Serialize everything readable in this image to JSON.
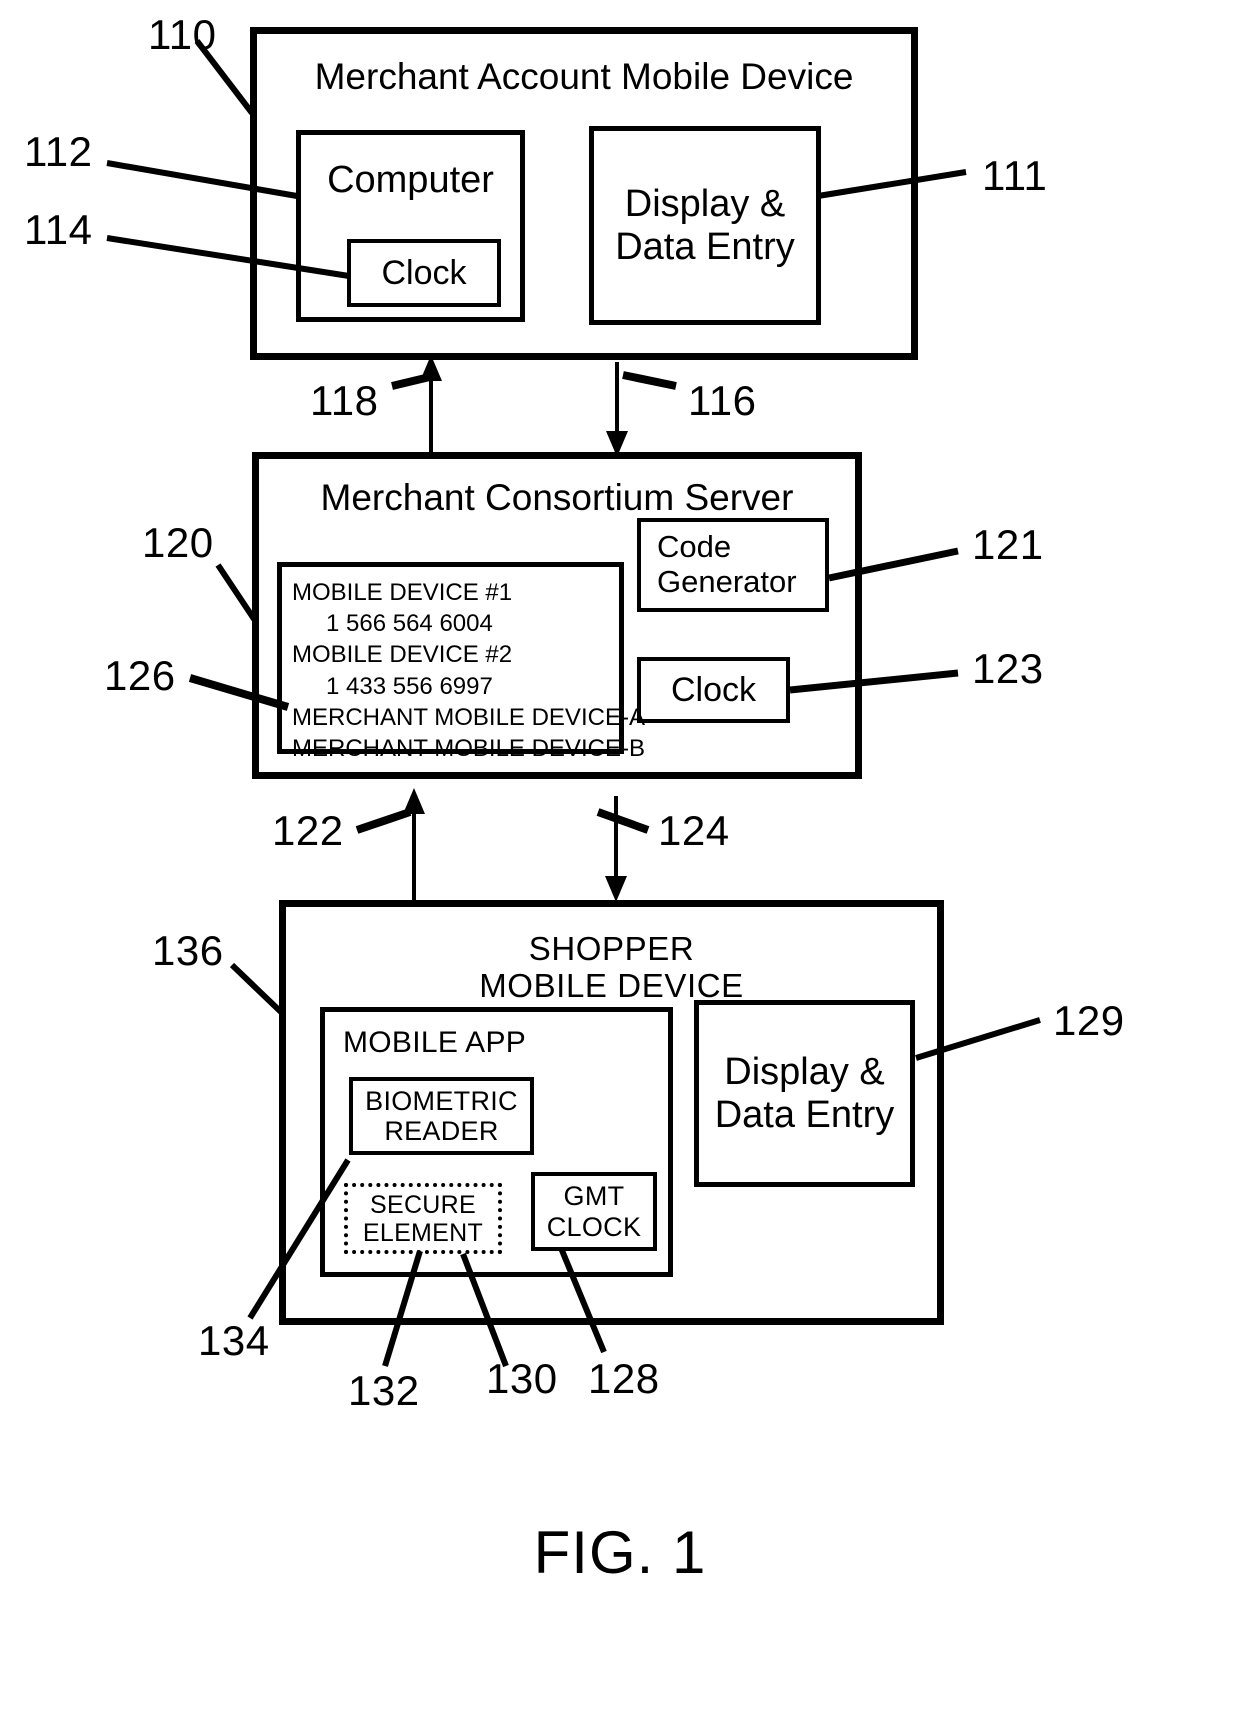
{
  "figure": {
    "caption": "FIG. 1"
  },
  "blocks": {
    "merchant_account_mobile_device": {
      "title": "Merchant Account Mobile Device",
      "ref": "110",
      "computer": {
        "label": "Computer",
        "ref": "112",
        "clock": {
          "label": "Clock",
          "ref": "114"
        }
      },
      "display_data_entry": {
        "label": "Display &\nData Entry",
        "ref": "111"
      }
    },
    "merchant_consortium_server": {
      "title": "Merchant Consortium Server",
      "ref": "120",
      "device_list": {
        "ref": "126",
        "lines": [
          {
            "text": "MOBILE DEVICE #1",
            "indent": false
          },
          {
            "text": "1 566 564 6004",
            "indent": true
          },
          {
            "text": "MOBILE DEVICE #2",
            "indent": false
          },
          {
            "text": "1 433 556 6997",
            "indent": true
          },
          {
            "text": "MERCHANT MOBILE DEVICE-A",
            "indent": false
          },
          {
            "text": "MERCHANT MOBILE DEVICE-B",
            "indent": false
          }
        ]
      },
      "code_generator": {
        "label": "Code\nGenerator",
        "ref": "121"
      },
      "clock": {
        "label": "Clock",
        "ref": "123"
      }
    },
    "shopper_mobile_device": {
      "title": "SHOPPER\nMOBILE DEVICE",
      "ref": "136",
      "mobile_app": {
        "label": "MOBILE APP",
        "ref": "130",
        "biometric_reader": {
          "label": "BIOMETRIC\nREADER",
          "ref": "134"
        },
        "secure_element": {
          "label": "SECURE\nELEMENT",
          "ref": "132"
        },
        "gmt_clock": {
          "label": "GMT\nCLOCK",
          "ref": "128"
        }
      },
      "display_data_entry": {
        "label": "Display &\nData Entry",
        "ref": "129"
      }
    }
  },
  "connectors": [
    {
      "ref": "118",
      "direction": "up",
      "from": "merchant-consortium-server",
      "to": "merchant-account-mobile-device"
    },
    {
      "ref": "116",
      "direction": "down",
      "from": "merchant-account-mobile-device",
      "to": "merchant-consortium-server"
    },
    {
      "ref": "122",
      "direction": "up",
      "from": "shopper-mobile-device",
      "to": "merchant-consortium-server"
    },
    {
      "ref": "124",
      "direction": "down",
      "from": "merchant-consortium-server",
      "to": "shopper-mobile-device"
    }
  ],
  "colors": {
    "ink": "#000000",
    "paper": "#ffffff"
  }
}
